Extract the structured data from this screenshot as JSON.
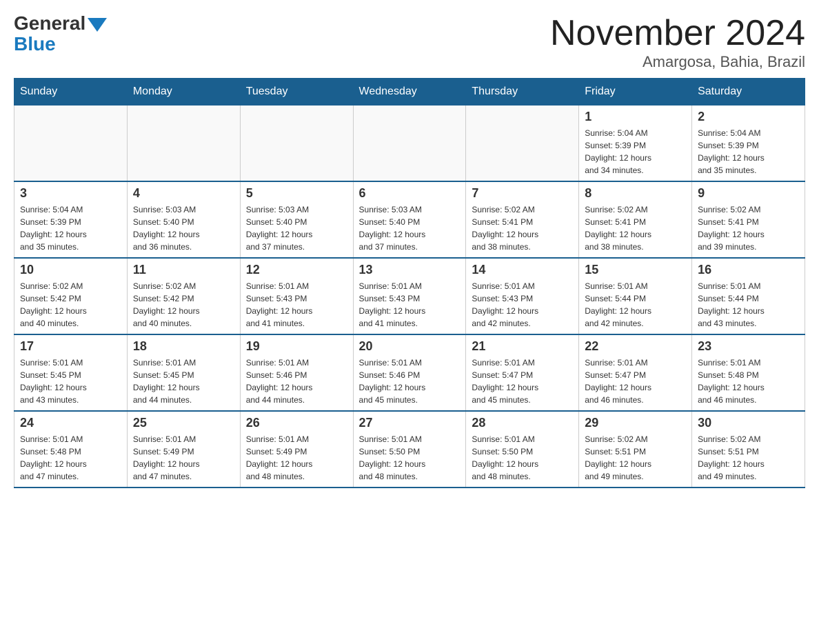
{
  "header": {
    "logo_general": "General",
    "logo_blue": "Blue",
    "title": "November 2024",
    "subtitle": "Amargosa, Bahia, Brazil"
  },
  "days_of_week": [
    "Sunday",
    "Monday",
    "Tuesday",
    "Wednesday",
    "Thursday",
    "Friday",
    "Saturday"
  ],
  "weeks": [
    [
      {
        "day": "",
        "info": ""
      },
      {
        "day": "",
        "info": ""
      },
      {
        "day": "",
        "info": ""
      },
      {
        "day": "",
        "info": ""
      },
      {
        "day": "",
        "info": ""
      },
      {
        "day": "1",
        "info": "Sunrise: 5:04 AM\nSunset: 5:39 PM\nDaylight: 12 hours\nand 34 minutes."
      },
      {
        "day": "2",
        "info": "Sunrise: 5:04 AM\nSunset: 5:39 PM\nDaylight: 12 hours\nand 35 minutes."
      }
    ],
    [
      {
        "day": "3",
        "info": "Sunrise: 5:04 AM\nSunset: 5:39 PM\nDaylight: 12 hours\nand 35 minutes."
      },
      {
        "day": "4",
        "info": "Sunrise: 5:03 AM\nSunset: 5:40 PM\nDaylight: 12 hours\nand 36 minutes."
      },
      {
        "day": "5",
        "info": "Sunrise: 5:03 AM\nSunset: 5:40 PM\nDaylight: 12 hours\nand 37 minutes."
      },
      {
        "day": "6",
        "info": "Sunrise: 5:03 AM\nSunset: 5:40 PM\nDaylight: 12 hours\nand 37 minutes."
      },
      {
        "day": "7",
        "info": "Sunrise: 5:02 AM\nSunset: 5:41 PM\nDaylight: 12 hours\nand 38 minutes."
      },
      {
        "day": "8",
        "info": "Sunrise: 5:02 AM\nSunset: 5:41 PM\nDaylight: 12 hours\nand 38 minutes."
      },
      {
        "day": "9",
        "info": "Sunrise: 5:02 AM\nSunset: 5:41 PM\nDaylight: 12 hours\nand 39 minutes."
      }
    ],
    [
      {
        "day": "10",
        "info": "Sunrise: 5:02 AM\nSunset: 5:42 PM\nDaylight: 12 hours\nand 40 minutes."
      },
      {
        "day": "11",
        "info": "Sunrise: 5:02 AM\nSunset: 5:42 PM\nDaylight: 12 hours\nand 40 minutes."
      },
      {
        "day": "12",
        "info": "Sunrise: 5:01 AM\nSunset: 5:43 PM\nDaylight: 12 hours\nand 41 minutes."
      },
      {
        "day": "13",
        "info": "Sunrise: 5:01 AM\nSunset: 5:43 PM\nDaylight: 12 hours\nand 41 minutes."
      },
      {
        "day": "14",
        "info": "Sunrise: 5:01 AM\nSunset: 5:43 PM\nDaylight: 12 hours\nand 42 minutes."
      },
      {
        "day": "15",
        "info": "Sunrise: 5:01 AM\nSunset: 5:44 PM\nDaylight: 12 hours\nand 42 minutes."
      },
      {
        "day": "16",
        "info": "Sunrise: 5:01 AM\nSunset: 5:44 PM\nDaylight: 12 hours\nand 43 minutes."
      }
    ],
    [
      {
        "day": "17",
        "info": "Sunrise: 5:01 AM\nSunset: 5:45 PM\nDaylight: 12 hours\nand 43 minutes."
      },
      {
        "day": "18",
        "info": "Sunrise: 5:01 AM\nSunset: 5:45 PM\nDaylight: 12 hours\nand 44 minutes."
      },
      {
        "day": "19",
        "info": "Sunrise: 5:01 AM\nSunset: 5:46 PM\nDaylight: 12 hours\nand 44 minutes."
      },
      {
        "day": "20",
        "info": "Sunrise: 5:01 AM\nSunset: 5:46 PM\nDaylight: 12 hours\nand 45 minutes."
      },
      {
        "day": "21",
        "info": "Sunrise: 5:01 AM\nSunset: 5:47 PM\nDaylight: 12 hours\nand 45 minutes."
      },
      {
        "day": "22",
        "info": "Sunrise: 5:01 AM\nSunset: 5:47 PM\nDaylight: 12 hours\nand 46 minutes."
      },
      {
        "day": "23",
        "info": "Sunrise: 5:01 AM\nSunset: 5:48 PM\nDaylight: 12 hours\nand 46 minutes."
      }
    ],
    [
      {
        "day": "24",
        "info": "Sunrise: 5:01 AM\nSunset: 5:48 PM\nDaylight: 12 hours\nand 47 minutes."
      },
      {
        "day": "25",
        "info": "Sunrise: 5:01 AM\nSunset: 5:49 PM\nDaylight: 12 hours\nand 47 minutes."
      },
      {
        "day": "26",
        "info": "Sunrise: 5:01 AM\nSunset: 5:49 PM\nDaylight: 12 hours\nand 48 minutes."
      },
      {
        "day": "27",
        "info": "Sunrise: 5:01 AM\nSunset: 5:50 PM\nDaylight: 12 hours\nand 48 minutes."
      },
      {
        "day": "28",
        "info": "Sunrise: 5:01 AM\nSunset: 5:50 PM\nDaylight: 12 hours\nand 48 minutes."
      },
      {
        "day": "29",
        "info": "Sunrise: 5:02 AM\nSunset: 5:51 PM\nDaylight: 12 hours\nand 49 minutes."
      },
      {
        "day": "30",
        "info": "Sunrise: 5:02 AM\nSunset: 5:51 PM\nDaylight: 12 hours\nand 49 minutes."
      }
    ]
  ]
}
